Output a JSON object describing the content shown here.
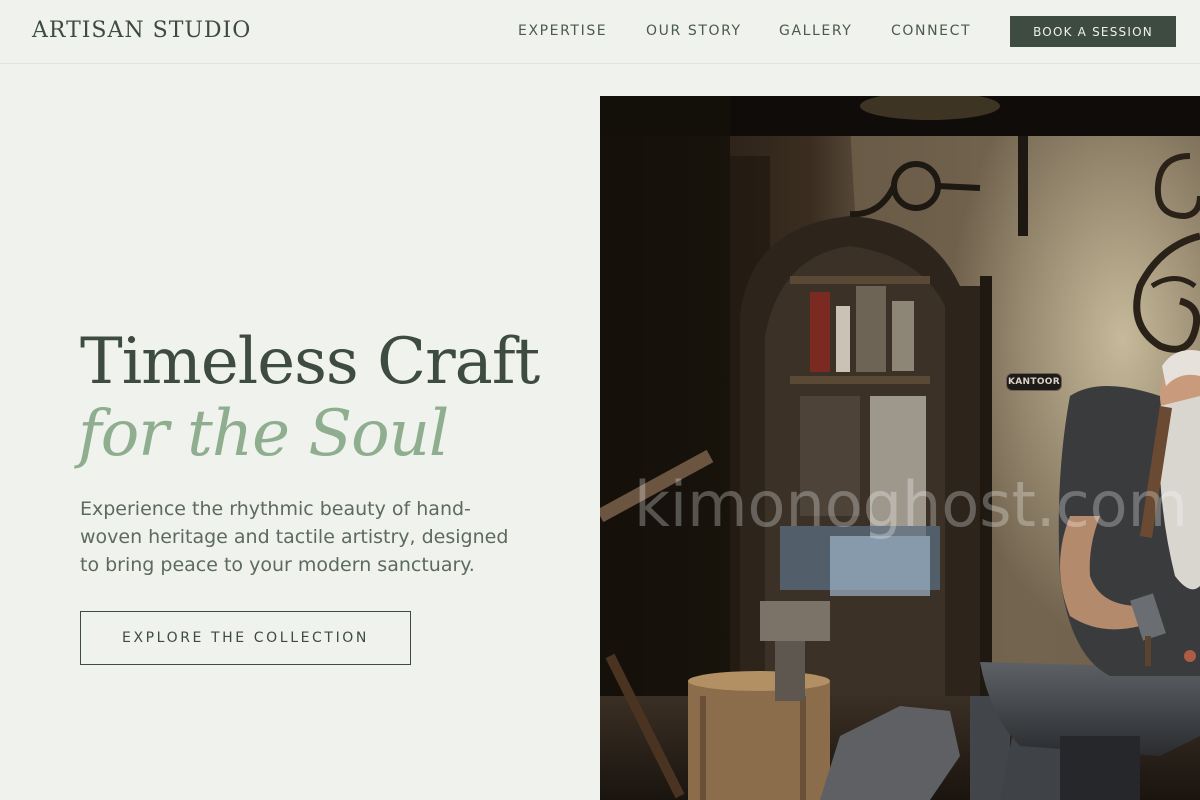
{
  "header": {
    "logo": "ARTISAN STUDIO",
    "nav": {
      "expertise": "EXPERTISE",
      "our_story": "OUR STORY",
      "gallery": "GALLERY",
      "connect": "CONNECT"
    },
    "cta_label": "BOOK A SESSION"
  },
  "hero": {
    "title": "Timeless Craft",
    "subtitle": "for the Soul",
    "description": "Experience the rhythmic beauty of hand-woven heritage and tactile artistry, designed to bring peace to your modern sanctuary.",
    "button_label": "EXPLORE THE COLLECTION"
  },
  "image": {
    "watermark": "kimonoghost.com",
    "sign_text": "KANTOOR"
  },
  "colors": {
    "background": "#f0f2ed",
    "primary": "#3e4b41",
    "accent": "#8fae8f",
    "text_muted": "#5c6a5f"
  }
}
